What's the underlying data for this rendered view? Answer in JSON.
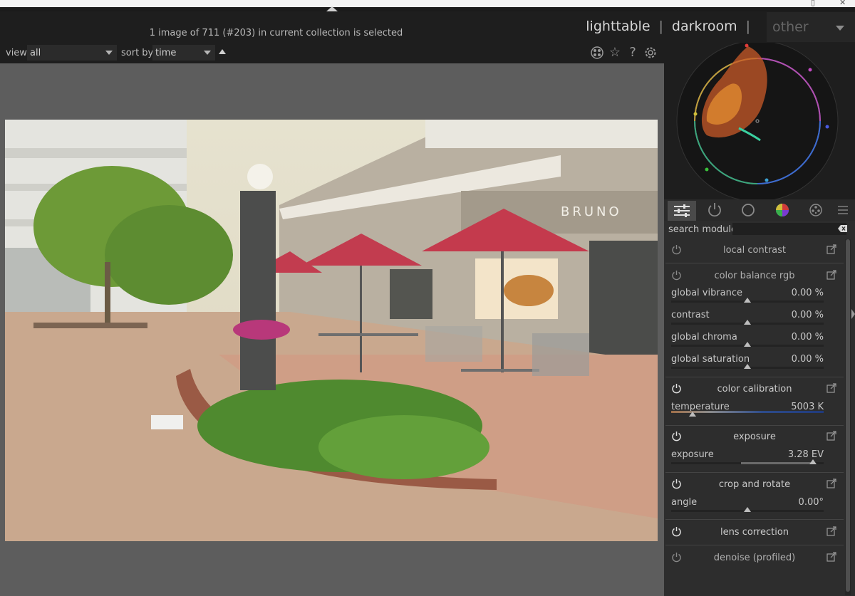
{
  "header": {
    "status": "1 image of 711 (#203) in current collection is selected",
    "views": [
      "lighttable",
      "darkroom"
    ],
    "separator": "|",
    "other": "other"
  },
  "filter": {
    "view_label": "view",
    "view_value": "all",
    "sort_label": "sort by",
    "sort_value": "time"
  },
  "toolbar_icons": [
    "grouping-icon",
    "star-icon",
    "help-icon",
    "gear-icon"
  ],
  "module_tabs": [
    "sliders-icon",
    "power-icon",
    "circle-icon",
    "color-wheel-icon",
    "film-icon",
    "menu-icon"
  ],
  "search": {
    "label": "search module",
    "placeholder": ""
  },
  "modules": {
    "local_contrast": {
      "title": "local contrast"
    },
    "color_balance": {
      "title": "color balance rgb",
      "sliders": [
        {
          "label": "global vibrance",
          "value": "0.00 %",
          "fraction": 0.5
        },
        {
          "label": "contrast",
          "value": "0.00 %",
          "fraction": 0.5
        },
        {
          "label": "global chroma",
          "value": "0.00 %",
          "fraction": 0.5
        },
        {
          "label": "global saturation",
          "value": "0.00 %",
          "fraction": 0.5
        }
      ]
    },
    "color_calibration": {
      "title": "color calibration",
      "label": "temperature",
      "value": "5003 K",
      "fraction": 0.14
    },
    "exposure": {
      "title": "exposure",
      "label": "exposure",
      "value": "3.28 EV",
      "fraction": 0.93
    },
    "crop": {
      "title": "crop and rotate",
      "label": "angle",
      "value": "0.00°",
      "fraction": 0.5
    },
    "lens": {
      "title": "lens correction"
    },
    "denoise": {
      "title": "denoise (profiled)"
    }
  }
}
